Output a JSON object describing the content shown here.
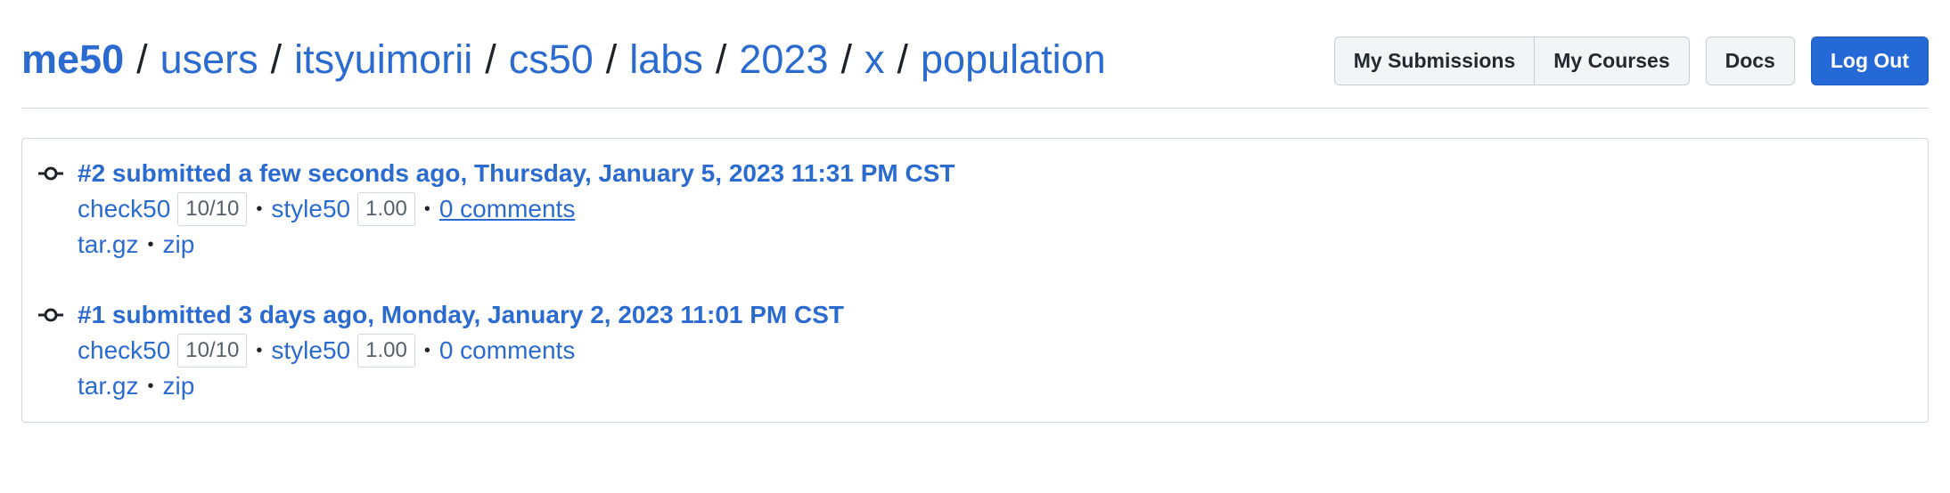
{
  "breadcrumb": {
    "home": "me50",
    "separator": "/",
    "parts": [
      "users",
      "itsyuimorii",
      "cs50",
      "labs",
      "2023",
      "x",
      "population"
    ]
  },
  "header_buttons": {
    "my_submissions": "My Submissions",
    "my_courses": "My Courses",
    "docs": "Docs",
    "log_out": "Log Out"
  },
  "submissions": [
    {
      "title": "#2 submitted a few seconds ago, Thursday, January 5, 2023 11:31 PM CST",
      "check50_label": "check50",
      "check50_score": "10/10",
      "style50_label": "style50",
      "style50_score": "1.00",
      "comments": "0 comments",
      "download_targz": "tar.gz",
      "download_zip": "zip"
    },
    {
      "title": "#1 submitted 3 days ago, Monday, January 2, 2023 11:01 PM CST",
      "check50_label": "check50",
      "check50_score": "10/10",
      "style50_label": "style50",
      "style50_score": "1.00",
      "comments": "0 comments",
      "download_targz": "tar.gz",
      "download_zip": "zip"
    }
  ],
  "bullet": "•",
  "colors": {
    "link": "#2b6bd0",
    "primary_button": "#2469d6",
    "border": "#d0d7de"
  },
  "icons": {
    "commit": "git-commit-icon"
  }
}
